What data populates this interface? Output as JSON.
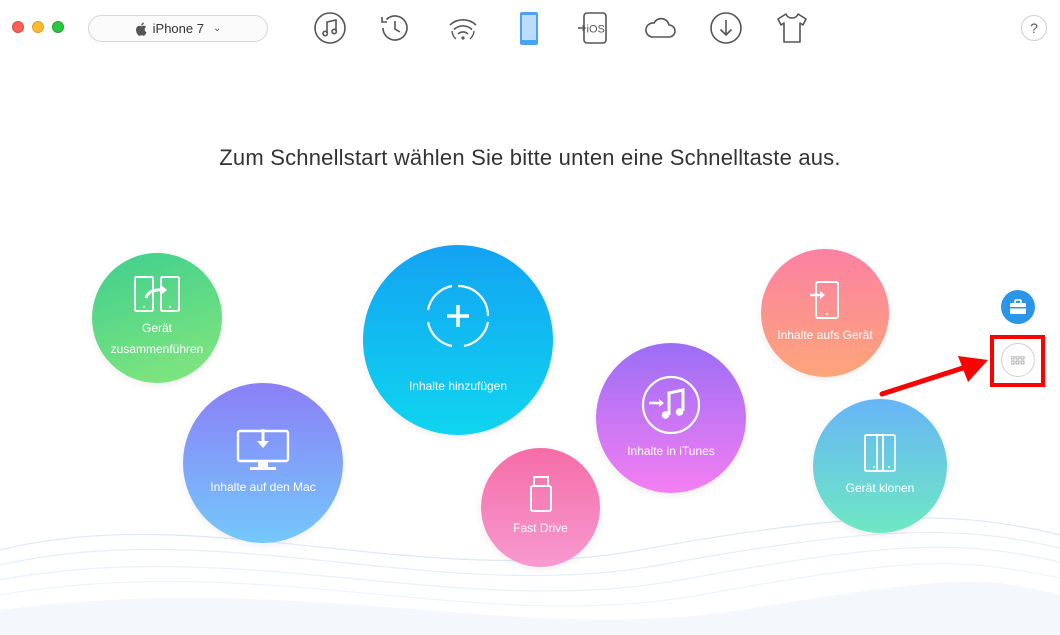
{
  "window": {
    "device_selector": {
      "label": "iPhone 7"
    },
    "toolbar": {
      "items": [
        {
          "name": "music"
        },
        {
          "name": "history"
        },
        {
          "name": "wifi"
        },
        {
          "name": "device"
        },
        {
          "name": "ios-mover",
          "label": "iOS"
        },
        {
          "name": "icloud"
        },
        {
          "name": "download"
        },
        {
          "name": "shirt"
        }
      ]
    },
    "help": {
      "label": "?"
    }
  },
  "main": {
    "headline": "Zum Schnellstart wählen Sie bitte unten eine Schnelltaste aus.",
    "bubbles": {
      "merge": {
        "label": "Gerät zusammenführen"
      },
      "to_mac": {
        "label": "Inhalte auf den Mac"
      },
      "add": {
        "label": "Inhalte hinzufügen"
      },
      "fast_drive": {
        "label": "Fast Drive"
      },
      "to_itunes": {
        "label": "Inhalte in iTunes"
      },
      "to_device": {
        "label": "Inhalte aufs Gerät"
      },
      "clone": {
        "label": "Gerät klonen"
      }
    }
  },
  "colors": {
    "accent": "#2b95e7",
    "highlight": "#ff0000",
    "icon_gray": "#555555"
  }
}
